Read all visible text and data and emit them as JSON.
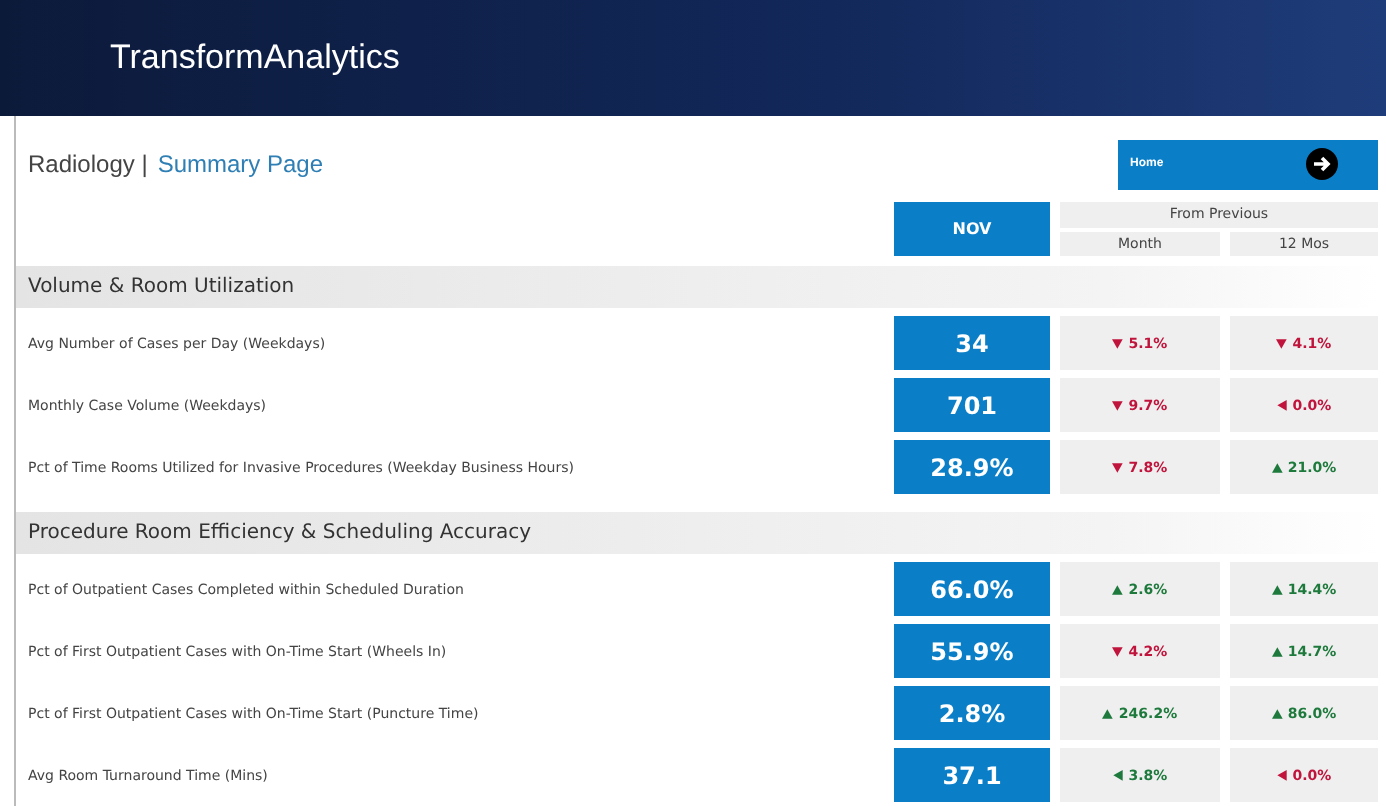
{
  "header": {
    "title": "TransformAnalytics"
  },
  "breadcrumb": {
    "section": "Radiology |",
    "page": "Summary Page"
  },
  "home_button": {
    "label": "Home"
  },
  "columns": {
    "current": "NOV",
    "group": "From Previous",
    "month": "Month",
    "year": "12 Mos"
  },
  "sections": [
    {
      "title": "Volume & Room Utilization",
      "rows": [
        {
          "label": "Avg Number of Cases per Day (Weekdays)",
          "value": "34",
          "month": {
            "kind": "down",
            "color": "#c0143c",
            "text": "5.1%"
          },
          "year": {
            "kind": "down",
            "color": "#c0143c",
            "text": "4.1%"
          }
        },
        {
          "label": "Monthly Case Volume (Weekdays)",
          "value": "701",
          "month": {
            "kind": "down",
            "color": "#c0143c",
            "text": "9.7%"
          },
          "year": {
            "kind": "flat",
            "color": "#c0143c",
            "text": "0.0%"
          }
        },
        {
          "label": "Pct of Time Rooms Utilized for Invasive Procedures (Weekday Business Hours)",
          "value": "28.9%",
          "month": {
            "kind": "down",
            "color": "#c0143c",
            "text": "7.8%"
          },
          "year": {
            "kind": "up",
            "color": "#1e7a3c",
            "text": "21.0%"
          }
        }
      ]
    },
    {
      "title": "Procedure Room Efficiency & Scheduling Accuracy",
      "rows": [
        {
          "label": "Pct of Outpatient Cases Completed within Scheduled Duration",
          "value": "66.0%",
          "month": {
            "kind": "up",
            "color": "#1e7a3c",
            "text": "2.6%"
          },
          "year": {
            "kind": "up",
            "color": "#1e7a3c",
            "text": "14.4%"
          }
        },
        {
          "label": "Pct of First Outpatient Cases with On-Time Start (Wheels In)",
          "value": "55.9%",
          "month": {
            "kind": "down",
            "color": "#c0143c",
            "text": "4.2%"
          },
          "year": {
            "kind": "up",
            "color": "#1e7a3c",
            "text": "14.7%"
          }
        },
        {
          "label": "Pct of First Outpatient Cases with On-Time Start (Puncture Time)",
          "value": "2.8%",
          "month": {
            "kind": "up",
            "color": "#1e7a3c",
            "text": "246.2%"
          },
          "year": {
            "kind": "up",
            "color": "#1e7a3c",
            "text": "86.0%"
          }
        },
        {
          "label": "Avg Room Turnaround Time (Mins)",
          "value": "37.1",
          "month": {
            "kind": "flat",
            "color": "#1e7a3c",
            "text": "3.8%"
          },
          "year": {
            "kind": "flat",
            "color": "#c0143c",
            "text": "0.0%"
          }
        }
      ]
    }
  ]
}
